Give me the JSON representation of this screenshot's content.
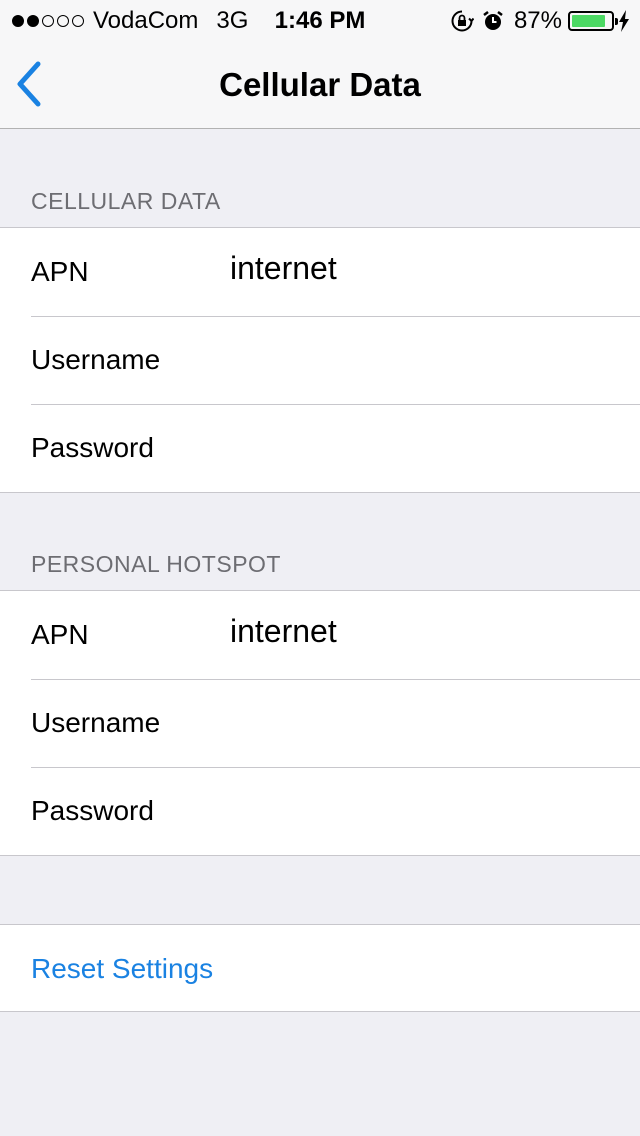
{
  "status_bar": {
    "carrier": "VodaCom",
    "network": "3G",
    "time": "1:46 PM",
    "battery_percent": "87%",
    "battery_level": 0.87,
    "signal_bars_filled": 2,
    "signal_bars_total": 5,
    "icons": [
      "orientation-lock-icon",
      "alarm-icon",
      "battery-icon",
      "charging-bolt-icon"
    ]
  },
  "nav": {
    "title": "Cellular Data",
    "back_icon": "chevron-left-icon",
    "accent_color": "#1a82e2"
  },
  "cellular_data": {
    "header": "CELLULAR DATA",
    "rows": [
      {
        "label": "APN",
        "value": "internet"
      },
      {
        "label": "Username",
        "value": ""
      },
      {
        "label": "Password",
        "value": ""
      }
    ]
  },
  "personal_hotspot": {
    "header": "PERSONAL HOTSPOT",
    "rows": [
      {
        "label": "APN",
        "value": "internet"
      },
      {
        "label": "Username",
        "value": ""
      },
      {
        "label": "Password",
        "value": ""
      }
    ]
  },
  "reset": {
    "label": "Reset Settings"
  }
}
